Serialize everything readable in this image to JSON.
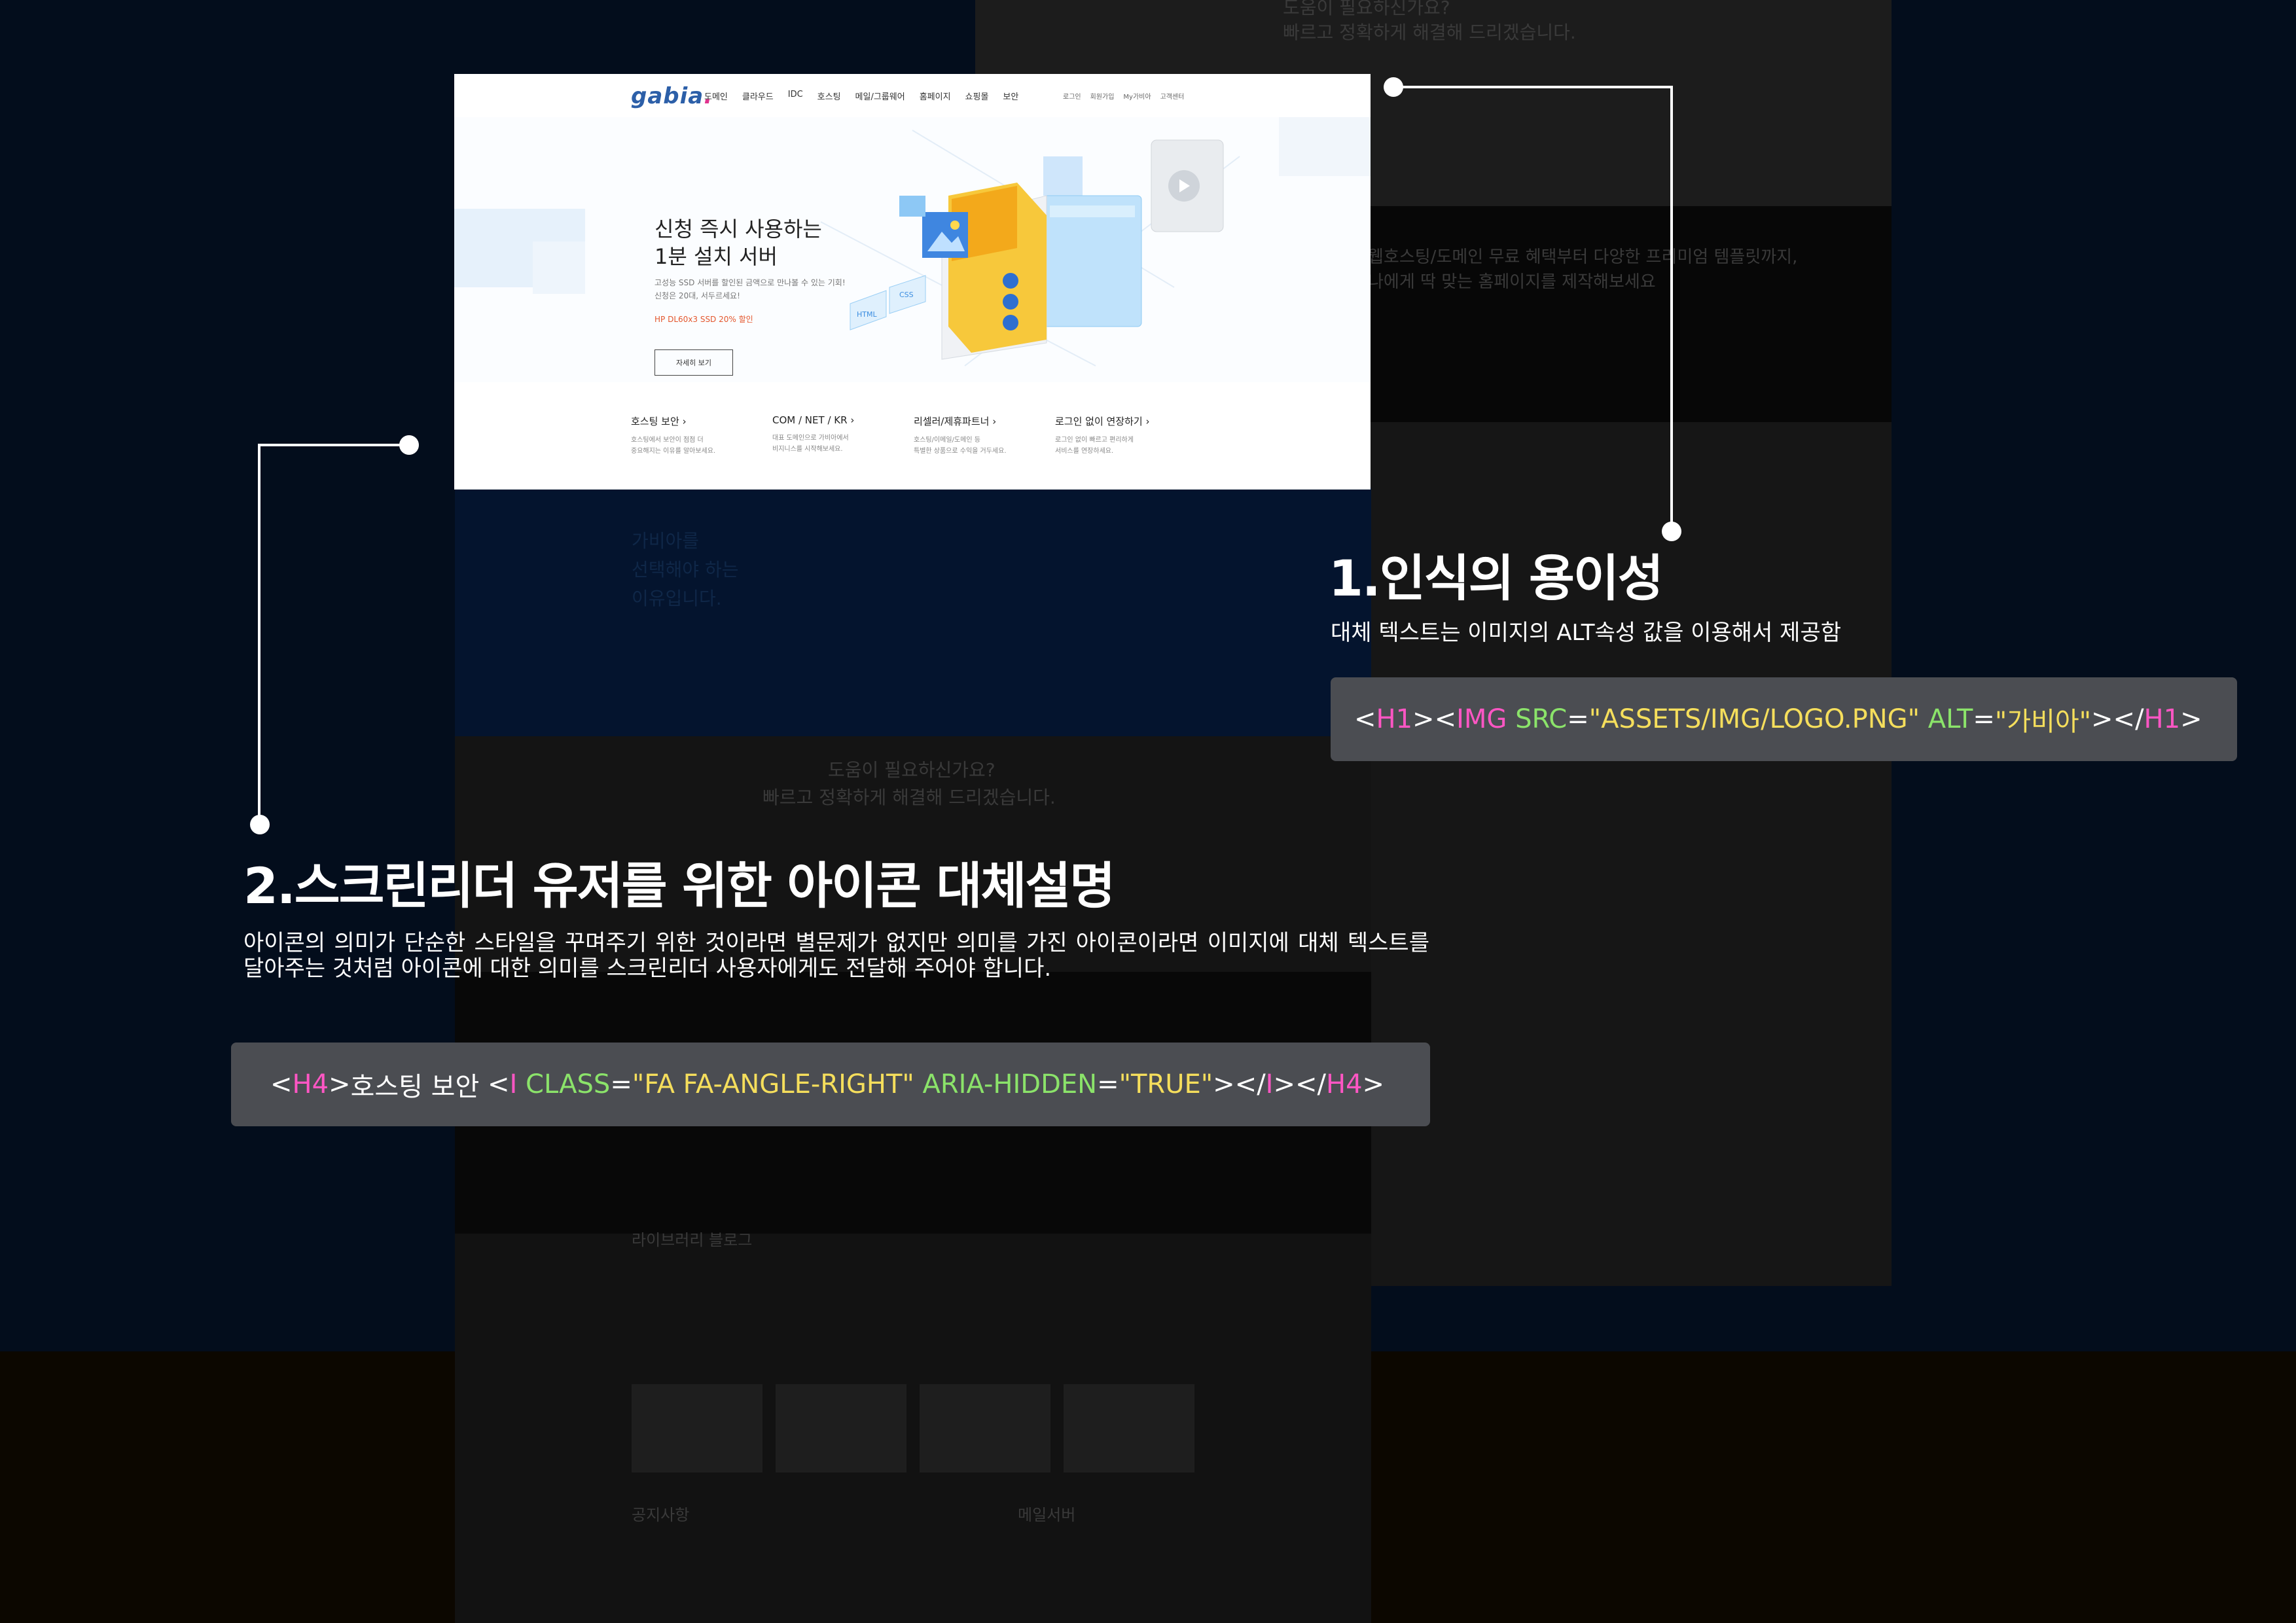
{
  "site": {
    "logo_text": "gabia",
    "logo_dot": ".",
    "nav_items": [
      "도메인",
      "클라우드",
      "IDC",
      "호스팅",
      "메일/그룹웨어",
      "홈페이지",
      "쇼핑몰",
      "보안"
    ],
    "util_links": [
      "로그인",
      "회원가입",
      "My가비아",
      "고객센터"
    ],
    "hero_title": "신청 즉시 사용하는\n1분 설치 서버",
    "hero_desc": "고성능 SSD 서버를 할인된 금액으로 만나볼 수 있는 기회!\n신청은 20대, 서두르세요!",
    "hero_promo": "HP DL60x3 SSD 20% 할인",
    "hero_button": "자세히 보기",
    "quick_links": [
      {
        "title": "호스팅 보안",
        "desc": "호스팅에서 보안이 점점 더\n중요해지는 이유를 알아보세요."
      },
      {
        "title": "COM / NET / KR",
        "desc": "대표 도메인으로 가비아에서\n비지니스를 시작해보세요."
      },
      {
        "title": "리셀러/제휴파트너",
        "desc": "호스팅/이메일/도메인 등\n특별한 상품으로 수익을 거두세요."
      },
      {
        "title": "로그인 없이 연장하기",
        "desc": "로그인 없이 빠르고 편리하게\n서비스를 연장하세요."
      }
    ]
  },
  "background": {
    "top_faint": "도움이 필요하신가요?",
    "top_faint_2": "빠르고 정확하게 해결해 드리겠습니다.",
    "promo_faint": "웹호스팅/도메인 무료 혜택부터 다양한 프리미엄 템플릿까지,",
    "promo_faint_2": "나에게 딱 맞는 홈페이지를 제작해보세요",
    "why_faint": "가비아를\n선택해야 하는\n이유입니다.",
    "help_faint": "도움이 필요하신가요?",
    "help_faint_2": "빠르고 정확하게 해결해 드리겠습니다.",
    "library_faint": "라이브러리 블로그",
    "notice_faint": "공지사항",
    "mail_faint": "메일서버"
  },
  "callout1": {
    "title": "1.인식의 용이성",
    "desc": "대체 텍스트는 이미지의 ALT속성 값을 이용해서 제공함",
    "code": {
      "p1": "<",
      "t1": "H1",
      "p2": "><",
      "t2": "IMG",
      "s1": " ",
      "a1": "SRC",
      "e1": "=",
      "v1": "\"ASSETS/IMG/LOGO.PNG\"",
      "s2": " ",
      "a2": "ALT",
      "e2": "=",
      "v2": "\"가비아\"",
      "p3": "></",
      "t3": "H1",
      "p4": ">"
    }
  },
  "callout2": {
    "title": "2.스크린리더 유저를 위한 아이콘 대체설명",
    "desc": "아이콘의 의미가 단순한 스타일을 꾸며주기 위한 것이라면 별문제가 없지만 의미를 가진 아이콘이라면 이미지에 대체 텍스트를 달아주는 것처럼 아이콘에 대한 의미를 스크린리더 사용자에게도 전달해 주어야 합니다.",
    "code": {
      "p1": "<",
      "t1": "H4",
      "p2": ">",
      "txt": "호스팅 보안 ",
      "p3": "<",
      "t2": "I",
      "s1": " ",
      "a1": "CLASS",
      "e1": "=",
      "v1": "\"FA FA-ANGLE-RIGHT\"",
      "s2": " ",
      "a2": "ARIA-HIDDEN",
      "e2": "=",
      "v2": "\"TRUE\"",
      "p4": "></",
      "t3": "I",
      "p5": "></",
      "t4": "H4",
      "p6": ">"
    }
  }
}
